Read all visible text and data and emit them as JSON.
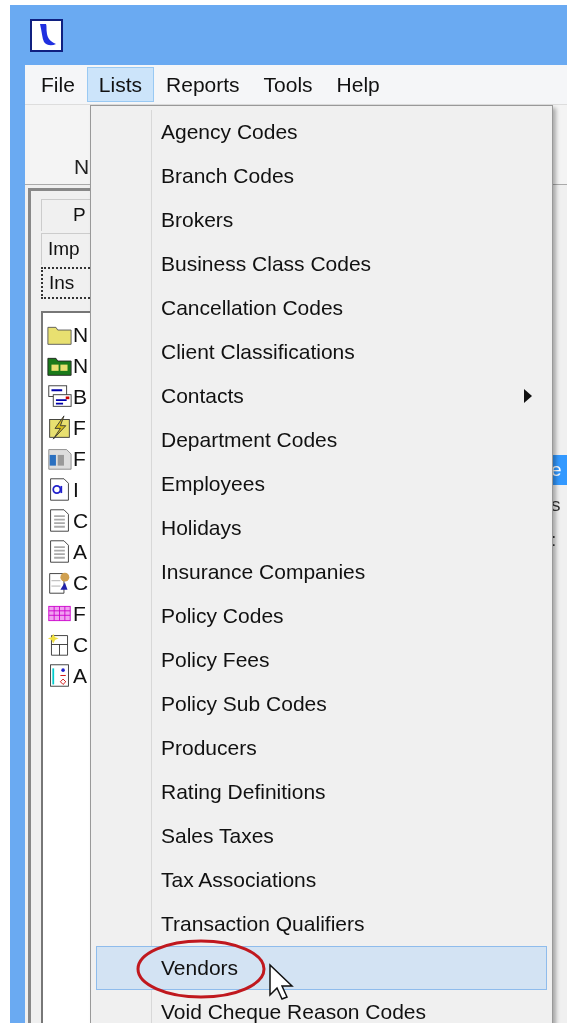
{
  "menu_bar": [
    {
      "label": "File",
      "selected": false
    },
    {
      "label": "Lists",
      "selected": true
    },
    {
      "label": "Reports",
      "selected": false
    },
    {
      "label": "Tools",
      "selected": false
    },
    {
      "label": "Help",
      "selected": false
    }
  ],
  "toolbar": {
    "left_label": "N"
  },
  "panel_tabs": [
    {
      "label": "P",
      "focused": false
    },
    {
      "label": "Imp",
      "focused": false
    },
    {
      "label": "Ins",
      "focused": true
    }
  ],
  "panel_items": [
    {
      "label": "N",
      "kind": "folder"
    },
    {
      "label": "N",
      "kind": "green-folder"
    },
    {
      "label": "B",
      "kind": "form"
    },
    {
      "label": "F",
      "kind": "lightning"
    },
    {
      "label": "F",
      "kind": "card"
    },
    {
      "label": "I",
      "kind": "blue-doc"
    },
    {
      "label": "C",
      "kind": "doc"
    },
    {
      "label": "A",
      "kind": "doc"
    },
    {
      "label": "C",
      "kind": "person"
    },
    {
      "label": "F",
      "kind": "grid"
    },
    {
      "label": "C",
      "kind": "star-doc"
    },
    {
      "label": "A",
      "kind": "info"
    }
  ],
  "right_rows": [
    {
      "label": "e",
      "selected": true
    },
    {
      "label": "s",
      "selected": false
    },
    {
      "label": ":",
      "selected": false
    }
  ],
  "dropdown": [
    {
      "label": "Agency Codes",
      "selected": false,
      "submenu": false
    },
    {
      "label": "Branch Codes",
      "selected": false,
      "submenu": false
    },
    {
      "label": "Brokers",
      "selected": false,
      "submenu": false
    },
    {
      "label": "Business Class Codes",
      "selected": false,
      "submenu": false
    },
    {
      "label": "Cancellation Codes",
      "selected": false,
      "submenu": false
    },
    {
      "label": "Client Classifications",
      "selected": false,
      "submenu": false
    },
    {
      "label": "Contacts",
      "selected": false,
      "submenu": true
    },
    {
      "label": "Department Codes",
      "selected": false,
      "submenu": false
    },
    {
      "label": "Employees",
      "selected": false,
      "submenu": false
    },
    {
      "label": "Holidays",
      "selected": false,
      "submenu": false
    },
    {
      "label": "Insurance Companies",
      "selected": false,
      "submenu": false
    },
    {
      "label": "Policy Codes",
      "selected": false,
      "submenu": false
    },
    {
      "label": "Policy Fees",
      "selected": false,
      "submenu": false
    },
    {
      "label": "Policy Sub Codes",
      "selected": false,
      "submenu": false
    },
    {
      "label": "Producers",
      "selected": false,
      "submenu": false
    },
    {
      "label": "Rating Definitions",
      "selected": false,
      "submenu": false
    },
    {
      "label": "Sales Taxes",
      "selected": false,
      "submenu": false
    },
    {
      "label": "Tax Associations",
      "selected": false,
      "submenu": false
    },
    {
      "label": "Transaction Qualifiers",
      "selected": false,
      "submenu": false
    },
    {
      "label": "Vendors",
      "selected": true,
      "submenu": false
    },
    {
      "label": "Void Cheque Reason Codes",
      "selected": false,
      "submenu": false
    }
  ]
}
